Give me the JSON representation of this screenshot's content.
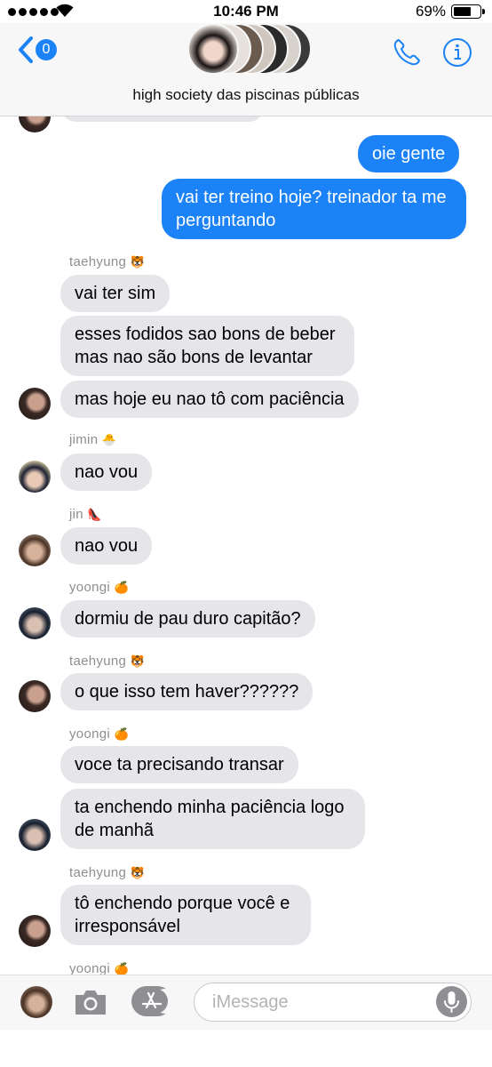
{
  "status_bar": {
    "time": "10:46 PM",
    "battery": "69%"
  },
  "nav": {
    "back_count": "0",
    "title": "high society das piscinas públicas"
  },
  "messages": [
    {
      "type": "out",
      "text": "oie gente"
    },
    {
      "type": "out",
      "text": "vai ter treino hoje? treinador ta me perguntando"
    },
    {
      "type": "sender",
      "name": "taehyung",
      "emoji": "🐯"
    },
    {
      "type": "in",
      "text": "vai ter sim"
    },
    {
      "type": "in",
      "text": "esses fodidos sao bons de beber mas nao são bons de levantar"
    },
    {
      "type": "in",
      "text": "mas hoje eu nao tô com paciência"
    },
    {
      "type": "sender",
      "name": "jimin",
      "emoji": "🐣"
    },
    {
      "type": "in",
      "text": "nao vou"
    },
    {
      "type": "sender",
      "name": "jin",
      "emoji": "👠"
    },
    {
      "type": "in",
      "text": "nao vou"
    },
    {
      "type": "sender",
      "name": "yoongi",
      "emoji": "🍊"
    },
    {
      "type": "in",
      "text": "dormiu de pau duro capitão?"
    },
    {
      "type": "sender",
      "name": "taehyung",
      "emoji": "🐯"
    },
    {
      "type": "in",
      "text": "o que isso tem haver??????"
    },
    {
      "type": "sender",
      "name": "yoongi",
      "emoji": "🍊"
    },
    {
      "type": "in",
      "text": "voce ta precisando transar"
    },
    {
      "type": "in",
      "text": "ta enchendo minha paciência logo de manhã"
    },
    {
      "type": "sender",
      "name": "taehyung",
      "emoji": "🐯"
    },
    {
      "type": "in",
      "text": "tô enchendo porque você e irresponsável"
    },
    {
      "type": "sender",
      "name": "yoongi",
      "emoji": "🍊"
    }
  ],
  "composer": {
    "placeholder": "iMessage"
  },
  "colors": {
    "accent": "#1b82f7",
    "incoming_bubble": "#e5e5ea",
    "header_bg": "#f7f7f8"
  }
}
